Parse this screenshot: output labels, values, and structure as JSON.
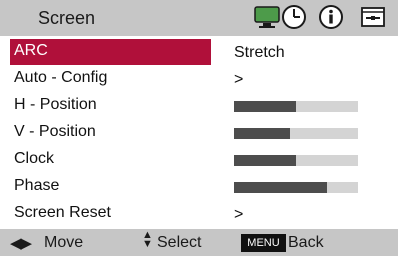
{
  "header": {
    "title": "Screen",
    "icons": [
      "screen-icon",
      "clock-icon",
      "info-icon",
      "option-icon"
    ]
  },
  "menu": {
    "selected_index": 0,
    "items": [
      {
        "label": "ARC",
        "value": "Stretch"
      },
      {
        "label": "Auto - Config",
        "value": ">"
      },
      {
        "label": "H - Position",
        "level": 0.5
      },
      {
        "label": "V - Position",
        "level": 0.45
      },
      {
        "label": "Clock",
        "level": 0.5
      },
      {
        "label": "Phase",
        "level": 0.75
      },
      {
        "label": "Screen Reset",
        "value": ">"
      }
    ]
  },
  "footer": {
    "move_label": "Move",
    "select_label": "Select",
    "menu_badge": "MENU",
    "back_label": "Back"
  },
  "colors": {
    "highlight": "#b0103a",
    "header_bg": "#c6c6c6",
    "bar_fill": "#4d4d4d",
    "bar_track": "#d4d4d4"
  }
}
